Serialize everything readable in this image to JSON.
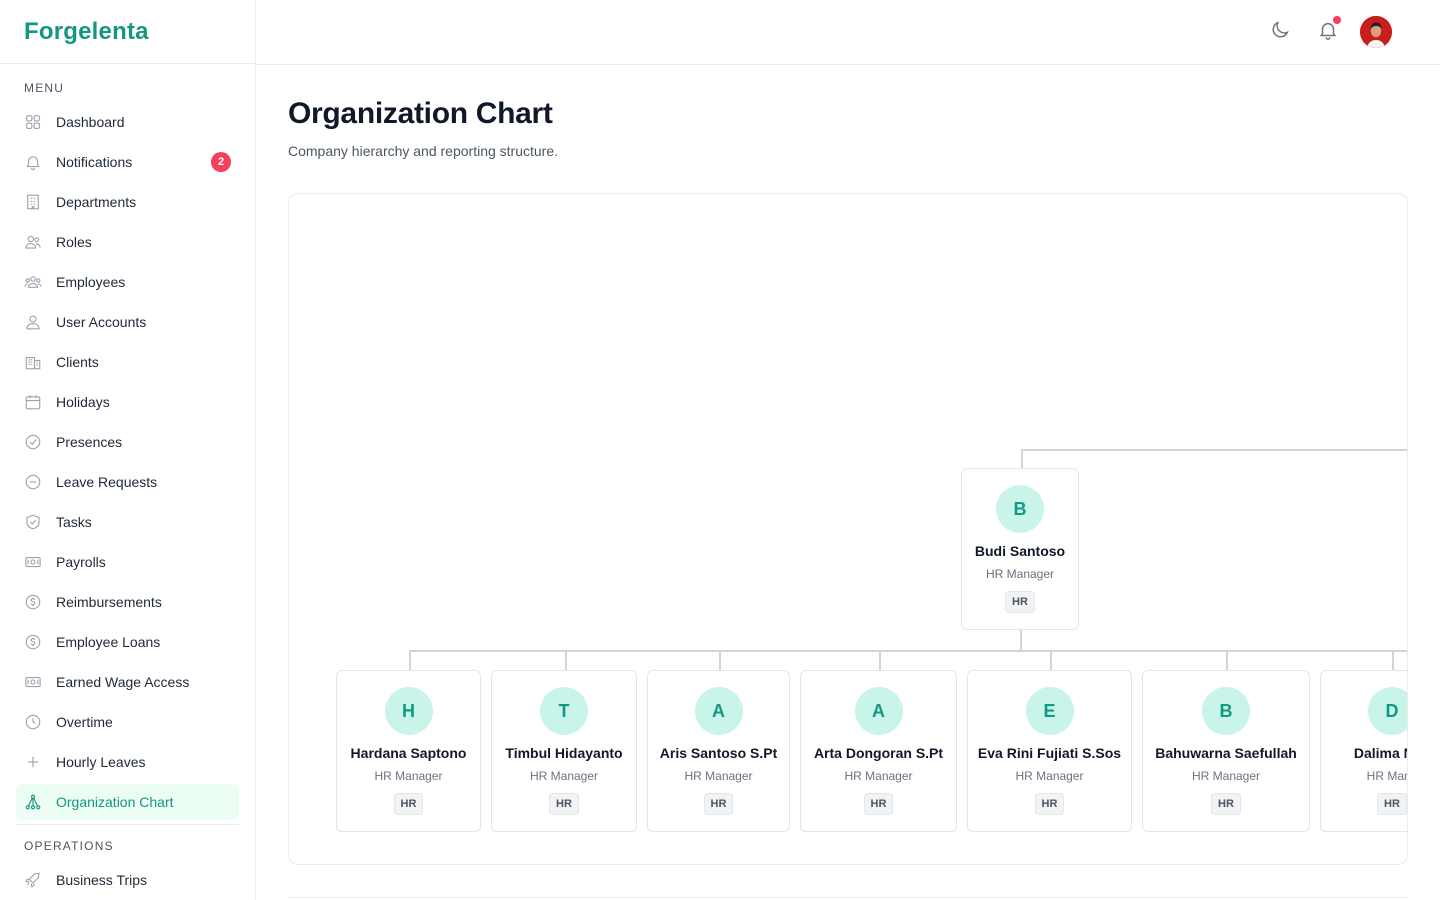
{
  "brand": {
    "name": "Forgelenta"
  },
  "sidebar": {
    "menu_label": "MENU",
    "items": [
      {
        "label": "Dashboard",
        "icon": "dashboard-icon"
      },
      {
        "label": "Notifications",
        "icon": "bell-icon",
        "badge": "2"
      },
      {
        "label": "Departments",
        "icon": "building-icon"
      },
      {
        "label": "Roles",
        "icon": "roles-icon"
      },
      {
        "label": "Employees",
        "icon": "users-icon"
      },
      {
        "label": "User Accounts",
        "icon": "user-icon"
      },
      {
        "label": "Clients",
        "icon": "office-icon"
      },
      {
        "label": "Holidays",
        "icon": "calendar-icon"
      },
      {
        "label": "Presences",
        "icon": "check-circle-icon"
      },
      {
        "label": "Leave Requests",
        "icon": "minus-circle-icon"
      },
      {
        "label": "Tasks",
        "icon": "shield-check-icon"
      },
      {
        "label": "Payrolls",
        "icon": "banknote-icon"
      },
      {
        "label": "Reimbursements",
        "icon": "dollar-circle-icon"
      },
      {
        "label": "Employee Loans",
        "icon": "dollar-circle-icon"
      },
      {
        "label": "Earned Wage Access",
        "icon": "banknote-icon"
      },
      {
        "label": "Overtime",
        "icon": "clock-icon"
      },
      {
        "label": "Hourly Leaves",
        "icon": "plus-icon"
      },
      {
        "label": "Organization Chart",
        "icon": "org-chart-icon",
        "active": true
      }
    ],
    "operations_label": "OPERATIONS",
    "operations_items": [
      {
        "label": "Business Trips",
        "icon": "rocket-icon"
      }
    ]
  },
  "header": {
    "theme_toggle_icon": "moon-icon",
    "notifications_icon": "bell-icon",
    "avatar": "user-avatar"
  },
  "page": {
    "title": "Organization Chart",
    "subtitle": "Company hierarchy and reporting structure."
  },
  "org_chart": {
    "root": {
      "initial": "B",
      "name": "Budi Santoso",
      "role": "HR Manager",
      "department": "HR"
    },
    "reports": [
      {
        "initial": "H",
        "name": "Hardana Saptono",
        "role": "HR Manager",
        "department": "HR"
      },
      {
        "initial": "T",
        "name": "Timbul Hidayanto",
        "role": "HR Manager",
        "department": "HR"
      },
      {
        "initial": "A",
        "name": "Aris Santoso S.Pt",
        "role": "HR Manager",
        "department": "HR"
      },
      {
        "initial": "A",
        "name": "Arta Dongoran S.Pt",
        "role": "HR Manager",
        "department": "HR"
      },
      {
        "initial": "E",
        "name": "Eva Rini Fujiati S.Sos",
        "role": "HR Manager",
        "department": "HR"
      },
      {
        "initial": "B",
        "name": "Bahuwarna Saefullah",
        "role": "HR Manager",
        "department": "HR"
      },
      {
        "initial": "D",
        "name": "Dalima Nov",
        "role": "HR Mana",
        "department": "HR"
      }
    ]
  },
  "colors": {
    "brand": "#17967f",
    "active_bg": "#ecfdf3",
    "badge": "#f43f5e",
    "avatar_circle": "#c9f4ea"
  }
}
